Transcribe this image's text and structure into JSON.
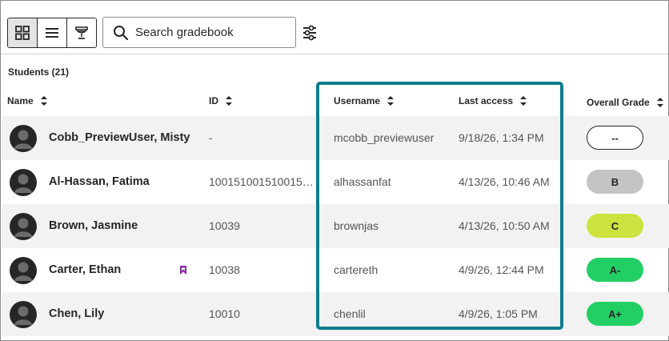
{
  "toolbar": {
    "view_modes": [
      {
        "name": "grid-view",
        "icon": "grid-icon",
        "active": true
      },
      {
        "name": "list-view",
        "icon": "list-icon",
        "active": false
      },
      {
        "name": "trophy-view",
        "icon": "trophy-icon",
        "active": false
      }
    ],
    "search": {
      "placeholder": "Search gradebook",
      "value": ""
    },
    "filter_icon": "sliders-icon"
  },
  "students_label": "Students (21)",
  "columns": {
    "name": "Name",
    "id": "ID",
    "username": "Username",
    "last_access": "Last access",
    "overall_grade": "Overall Grade"
  },
  "rows": [
    {
      "name": "Cobb_PreviewUser, Misty",
      "id": "-",
      "username": "mcobb_previewuser",
      "last_access": "9/18/26, 1:34 PM",
      "grade": "--",
      "grade_color": "#ffffff",
      "flagged": false
    },
    {
      "name": "Al-Hassan, Fatima",
      "id": "100151001510015…",
      "username": "alhassanfat",
      "last_access": "4/13/26, 10:46 AM",
      "grade": "B",
      "grade_color": "#c4c4c4",
      "flagged": false
    },
    {
      "name": "Brown, Jasmine",
      "id": "10039",
      "username": "brownjas",
      "last_access": "4/13/26, 10:50 AM",
      "grade": "C",
      "grade_color": "#cde23f",
      "flagged": false
    },
    {
      "name": "Carter, Ethan",
      "id": "10038",
      "username": "cartereth",
      "last_access": "4/9/26, 12:44 PM",
      "grade": "A-",
      "grade_color": "#22cf64",
      "flagged": true
    },
    {
      "name": "Chen, Lily",
      "id": "10010",
      "username": "chenlil",
      "last_access": "4/9/26, 1:05 PM",
      "grade": "A+",
      "grade_color": "#22cf64",
      "flagged": false
    }
  ],
  "colors": {
    "highlight": "#0e7c8c",
    "flag": "#8c2fa3"
  }
}
